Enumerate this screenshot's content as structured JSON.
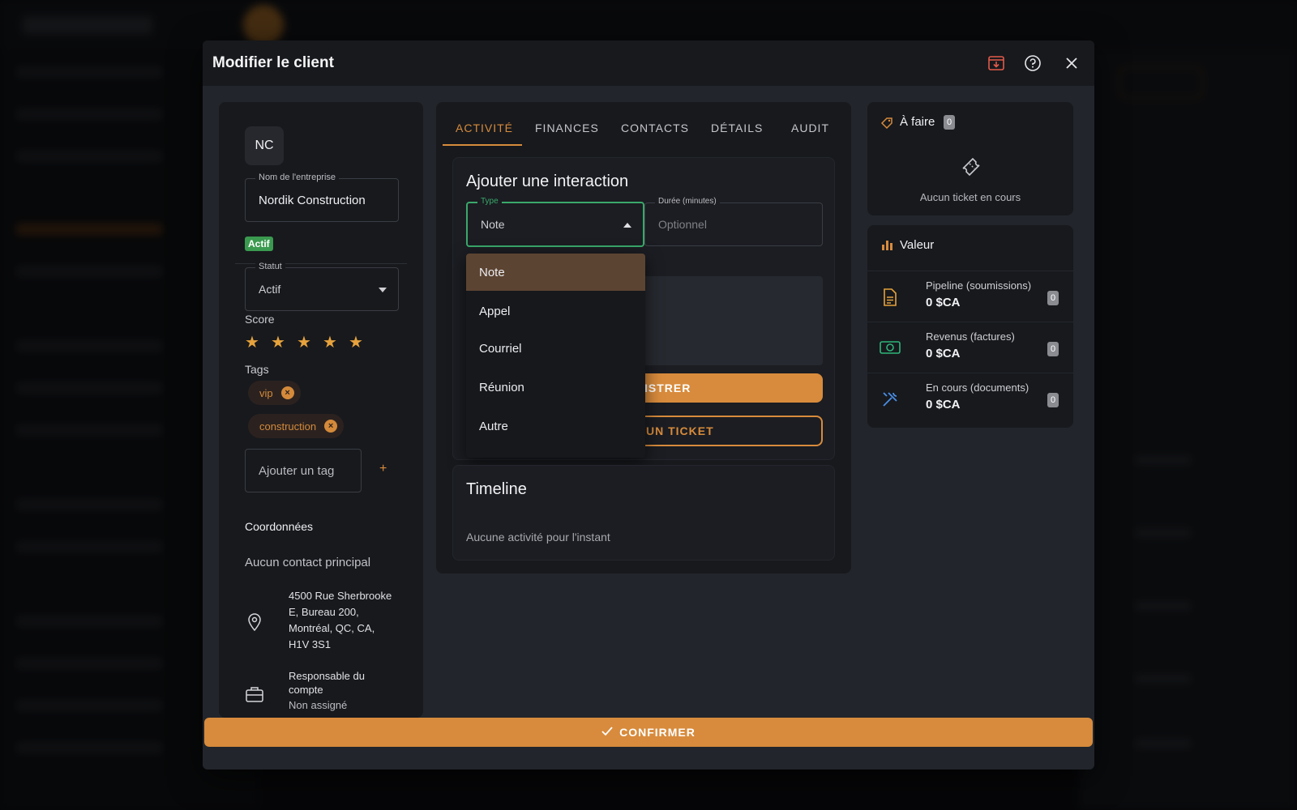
{
  "modal": {
    "title": "Modifier le client",
    "confirm_label": "CONFIRMER"
  },
  "left_panel": {
    "initials": "NC",
    "company_label": "Nom de l'entreprise",
    "company_value": "Nordik Construction",
    "active_badge": "Actif",
    "status_label": "Statut",
    "status_value": "Actif",
    "score_label": "Score",
    "score_value": 5,
    "score_max": 5,
    "tags_label": "Tags",
    "tags": [
      "vip",
      "construction"
    ],
    "add_tag_placeholder": "Ajouter un tag",
    "add_tag_button": "+",
    "coords_label": "Coordonnées",
    "no_contact": "Aucun contact principal",
    "address_lines": [
      "4500 Rue Sherbrooke",
      "E, Bureau 200,",
      "Montréal, QC, CA,",
      "H1V 3S1"
    ],
    "responsible_label_lines": [
      "Responsable du",
      "compte"
    ],
    "responsible_value": "Non assigné"
  },
  "tabs": [
    {
      "label": "ACTIVITÉ",
      "active": true
    },
    {
      "label": "FINANCES",
      "active": false
    },
    {
      "label": "CONTACTS",
      "active": false
    },
    {
      "label": "DÉTAILS",
      "active": false
    },
    {
      "label": "AUDIT",
      "active": false
    }
  ],
  "interaction": {
    "title": "Ajouter une interaction",
    "type_label": "Type",
    "type_value": "Note",
    "duration_label": "Durée (minutes)",
    "duration_placeholder": "Optionnel",
    "save_label_visible": "ISTRER",
    "ticket_label_visible": "UN TICKET",
    "type_options": [
      "Note",
      "Appel",
      "Courriel",
      "Réunion",
      "Autre"
    ],
    "type_selected": "Note"
  },
  "timeline": {
    "title": "Timeline",
    "empty": "Aucune activité pour l'instant"
  },
  "todo": {
    "title": "À faire",
    "count": "0",
    "empty": "Aucun ticket en cours"
  },
  "valeur": {
    "title": "Valeur",
    "rows": [
      {
        "label": "Pipeline (soumissions)",
        "amount": "0 $CA",
        "count": "0",
        "icon": "document-icon"
      },
      {
        "label": "Revenus (factures)",
        "amount": "0 $CA",
        "count": "0",
        "icon": "cash-icon"
      },
      {
        "label": "En cours (documents)",
        "amount": "0 $CA",
        "count": "0",
        "icon": "tools-icon"
      }
    ]
  },
  "colors": {
    "accent": "#d88b3c",
    "active_green": "#3a9a4f",
    "focus_green": "#3aa86a",
    "modal_bg": "#22252b",
    "card_bg": "#17191d"
  }
}
